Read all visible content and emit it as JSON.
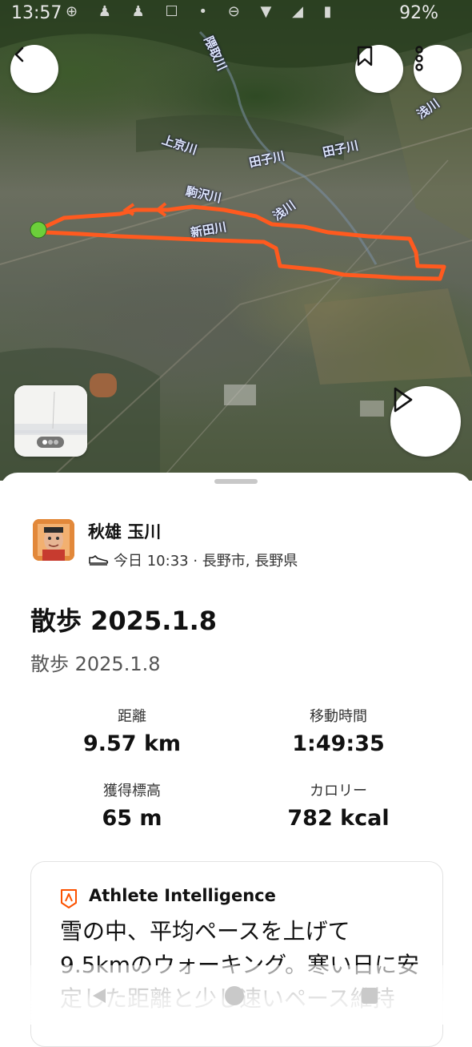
{
  "status_bar": {
    "time": "13:57",
    "battery": "92%"
  },
  "map": {
    "river_labels": [
      "隈取川",
      "上京川",
      "田子川",
      "田子川",
      "駒沢川",
      "浅川",
      "新田川",
      "浅川"
    ]
  },
  "activity": {
    "athlete_name": "秋雄 玉川",
    "meta": "今日 10:33 · 長野市, 長野県",
    "title": "散歩 2025.1.8",
    "description": "散歩 2025.1.8",
    "stats": [
      {
        "label": "距離",
        "value": "9.57 km"
      },
      {
        "label": "移動時間",
        "value": "1:49:35"
      },
      {
        "label": "獲得標高",
        "value": "65 m"
      },
      {
        "label": "カロリー",
        "value": "782 kcal"
      }
    ]
  },
  "athlete_intelligence": {
    "title": "Athlete Intelligence",
    "text": "雪の中、平均ペースを上げて9.5kmのウォーキング。寒い日に安定した距離と少し速いペース維持"
  },
  "colors": {
    "route": "#ff5a1f",
    "start_marker": "#6ccf3a",
    "ai_icon": "#fc5200"
  }
}
